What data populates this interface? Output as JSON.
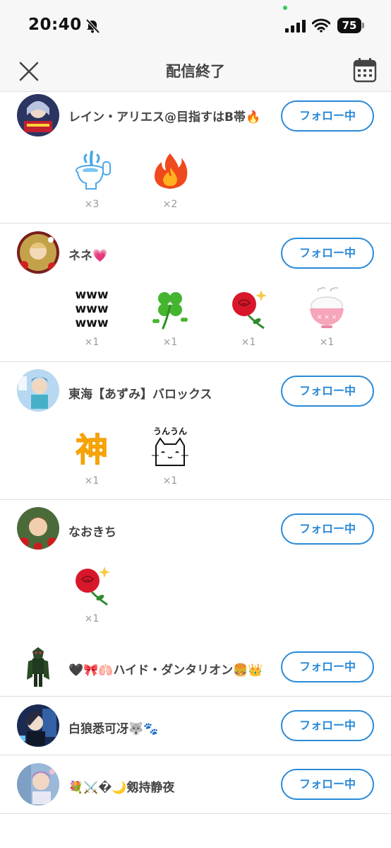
{
  "status_bar": {
    "time": "20:40",
    "battery": "75"
  },
  "nav": {
    "title": "配信終了"
  },
  "colors": {
    "accent": "#2a8ad8",
    "divider": "#dcdcdc"
  },
  "entries": [
    {
      "name": "レイン・アリエス@目指すはB帯🔥",
      "follow_label": "フォロー中",
      "gifts": [
        {
          "icon": "toilet-fountain-icon",
          "count": "×3"
        },
        {
          "icon": "fire-icon",
          "count": "×2"
        }
      ]
    },
    {
      "name": "ネネ💗",
      "follow_label": "フォロー中",
      "gifts": [
        {
          "icon": "www-text-icon",
          "count": "×1"
        },
        {
          "icon": "four-leaf-clover-icon",
          "count": "×1"
        },
        {
          "icon": "red-rose-icon",
          "count": "×1"
        },
        {
          "icon": "rice-bowl-icon",
          "count": "×1"
        }
      ]
    },
    {
      "name": "東海【あずみ】バロックス",
      "follow_label": "フォロー中",
      "gifts": [
        {
          "icon": "kami-kanji-icon",
          "count": "×1"
        },
        {
          "icon": "unun-cat-icon",
          "count": "×1"
        }
      ]
    },
    {
      "name": "なおきち",
      "follow_label": "フォロー中",
      "gifts": [
        {
          "icon": "red-rose-icon",
          "count": "×1"
        }
      ]
    },
    {
      "name": "🖤🎀🫁ハイド・ダンタリオン🍔👑",
      "follow_label": "フォロー中",
      "gifts": []
    },
    {
      "name": "白狼悉可冴🐺🐾",
      "follow_label": "フォロー中",
      "gifts": []
    },
    {
      "name": "💐⚔️�🌙剱持静夜",
      "follow_label": "フォロー中",
      "gifts": []
    }
  ]
}
